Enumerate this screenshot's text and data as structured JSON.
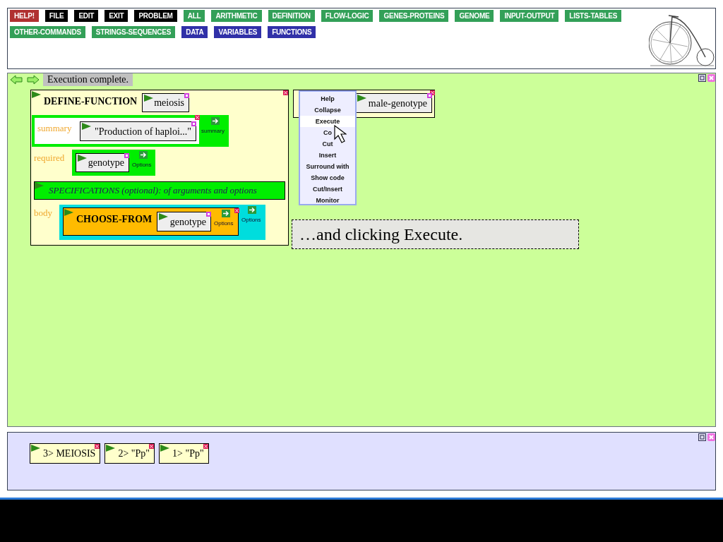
{
  "toolbar": {
    "buttons": [
      {
        "label": "HELP!",
        "kind": "help"
      },
      {
        "label": "FILE",
        "kind": "system"
      },
      {
        "label": "EDIT",
        "kind": "system"
      },
      {
        "label": "EXIT",
        "kind": "system"
      },
      {
        "label": "PROBLEM",
        "kind": "system"
      },
      {
        "label": "ALL",
        "kind": "category"
      },
      {
        "label": "ARITHMETIC",
        "kind": "category"
      },
      {
        "label": "DEFINITION",
        "kind": "category"
      },
      {
        "label": "FLOW-LOGIC",
        "kind": "category"
      },
      {
        "label": "GENES-PROTEINS",
        "kind": "category"
      },
      {
        "label": "GENOME",
        "kind": "category"
      },
      {
        "label": "INPUT-OUTPUT",
        "kind": "category"
      },
      {
        "label": "LISTS-TABLES",
        "kind": "category"
      },
      {
        "label": "OTHER-COMMANDS",
        "kind": "category"
      },
      {
        "label": "STRINGS-SEQUENCES",
        "kind": "category"
      },
      {
        "label": "DATA",
        "kind": "user"
      },
      {
        "label": "VARIABLES",
        "kind": "user"
      },
      {
        "label": "FUNCTIONS",
        "kind": "user"
      }
    ]
  },
  "workspace": {
    "status": "Execution complete.",
    "define_function": {
      "keyword": "DEFINE-FUNCTION",
      "name": "meiosis",
      "summary": {
        "label": "summary",
        "value": "\"Production of haploi...\"",
        "button": "summary"
      },
      "required": {
        "label": "required",
        "value": "genotype",
        "button": "Options"
      },
      "specifications": "SPECIFICATIONS (optional): of arguments and options",
      "body": {
        "label": "body",
        "keyword": "CHOOSE-FROM",
        "argument": "genotype",
        "inner_button": "Options",
        "outer_button": "Options"
      }
    },
    "second_block": {
      "value": "male-genotype"
    },
    "context_menu": [
      {
        "label": "Help",
        "selected": false
      },
      {
        "label": "Collapse",
        "selected": false
      },
      {
        "label": "Execute",
        "selected": true
      },
      {
        "label": "Co",
        "selected": false
      },
      {
        "label": "Cut",
        "selected": false
      },
      {
        "label": "Insert",
        "selected": false
      },
      {
        "label": "Surround with",
        "selected": false
      },
      {
        "label": "Show code",
        "selected": false
      },
      {
        "label": "Cut/Insert",
        "selected": false
      },
      {
        "label": "Monitor",
        "selected": false
      }
    ],
    "caption": "…and clicking Execute."
  },
  "results": [
    {
      "label": "3> MEIOSIS"
    },
    {
      "label": "2> \"Pp\""
    },
    {
      "label": "1> \"Pp\""
    }
  ]
}
